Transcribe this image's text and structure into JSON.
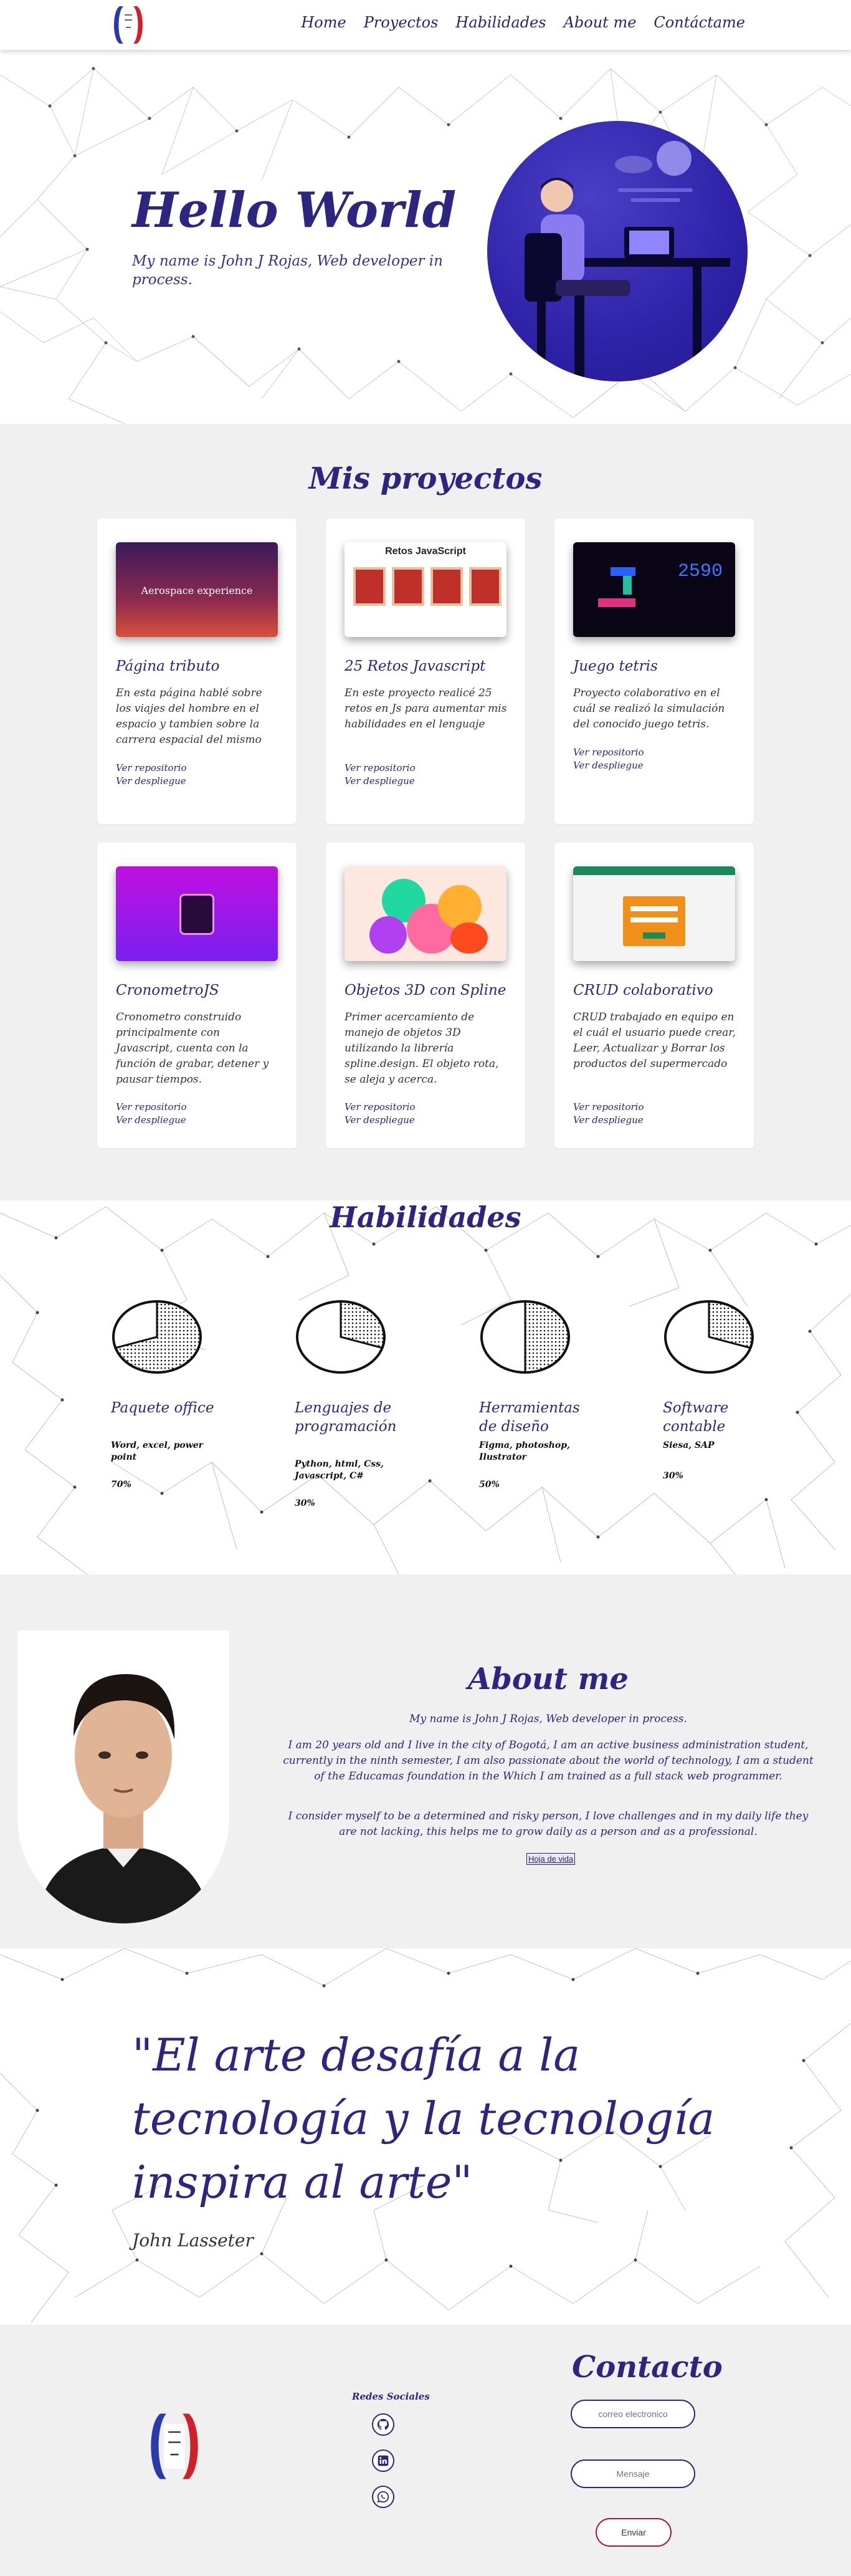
{
  "header": {
    "nav": [
      "Home",
      "Proyectos",
      "Habilidades",
      "About me",
      "Contáctame"
    ]
  },
  "hero": {
    "title": "Hello World",
    "subtitle": "My name is John J Rojas, Web developer in process."
  },
  "projects": {
    "title": "Mis proyectos",
    "repo_label": "Ver repositorio",
    "deploy_label": "Ver despliegue",
    "items": [
      {
        "title": "Página tributo",
        "thumb_text": "Aerospace experience",
        "description": "En esta página hablé sobre los viajes del hombre en el espacio y tambien sobre la carrera espacial del mismo"
      },
      {
        "title": "25 Retos Javascript",
        "thumb_text": "Retos JavaScript",
        "description": "En este proyecto realicé 25 retos en Js para aumentar mis habilidades en el lenguaje"
      },
      {
        "title": "Juego tetris",
        "thumb_text": "2590",
        "description": "Proyecto colaborativo en el cuál se realizó la simulación del conocido juego tetris."
      },
      {
        "title": "CronometroJS",
        "thumb_text": "",
        "description": "Cronometro construido principalmente con Javascript, cuenta con la función de grabar, detener y pausar tiempos."
      },
      {
        "title": "Objetos 3D con Spline",
        "thumb_text": "",
        "description": "Primer acercamiento de manejo de objetos 3D utilizando la librería spline.design. El objeto rota, se aleja y acerca."
      },
      {
        "title": "CRUD colaborativo",
        "thumb_text": "",
        "description": "CRUD trabajado en equipo en el cuál el usuario puede crear, Leer, Actualizar y Borrar los productos del supermercado"
      }
    ]
  },
  "skills": {
    "title": "Habilidades",
    "items": [
      {
        "title": "Paquete office",
        "tools": "Word, excel, power point",
        "percent": "70%",
        "level": 0.7
      },
      {
        "title": "Lenguajes de programación",
        "tools": "Python, html, Css, Javascript, C#",
        "percent": "30%",
        "level": 0.3
      },
      {
        "title": "Herramientas de diseño",
        "tools": "Figma, photoshop, Ilustrator",
        "percent": "50%",
        "level": 0.5
      },
      {
        "title": "Software contable",
        "tools": "Siesa, SAP",
        "percent": "30%",
        "level": 0.3
      }
    ]
  },
  "about": {
    "title": "About me",
    "intro": "My name is John J Rojas, Web developer in process.",
    "paragraph1": "I am 20 years old and I live in the city of Bogotá, I am an active business administration student, currently in the ninth semester, I am also passionate about the world of technology, I am a student of the Educamas foundation in the Which I am trained as a full stack web programmer.",
    "paragraph2": "I consider myself to be a determined and risky person, I love challenges and in my daily life they are not lacking, this helps me to grow daily as a person and as a professional.",
    "cv_link": "Hoja de vida"
  },
  "quote": {
    "text": "\"El arte desafía a la tecnología y la tecnología inspira al arte\"",
    "author": "John Lasseter"
  },
  "footer": {
    "social_title": "Redes Sociales",
    "social_icons": [
      "github-icon",
      "linkedin-icon",
      "whatsapp-icon"
    ],
    "contact_title": "Contacto",
    "email_placeholder": "correo electronico",
    "message_placeholder": "Mensaje",
    "send_label": "Enviar"
  },
  "colors": {
    "accent": "#2d2580",
    "section_gray": "#f0f0f0",
    "send_border": "#b0182a"
  }
}
